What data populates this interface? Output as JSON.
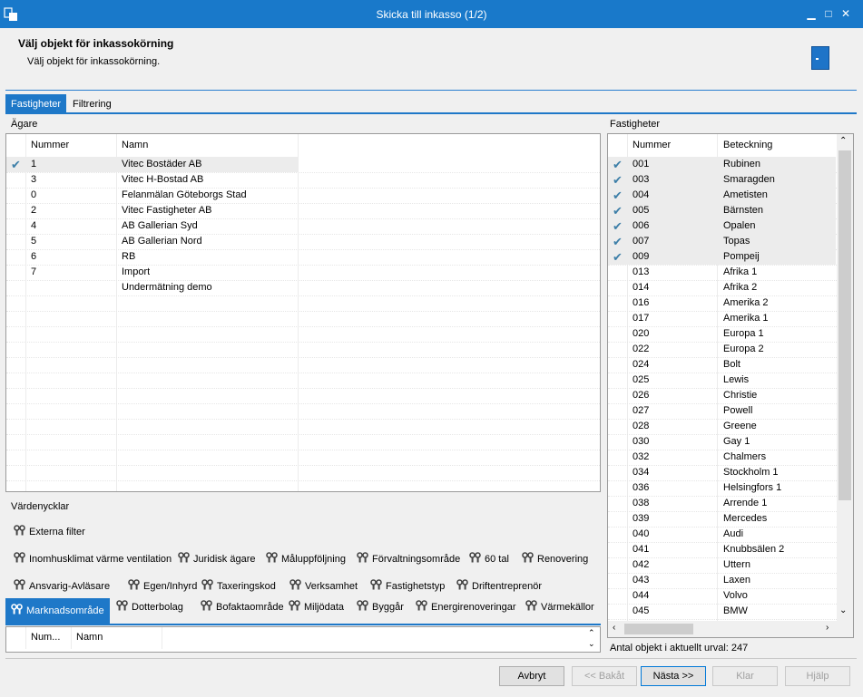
{
  "window": {
    "title": "Skicka till inkasso (1/2)",
    "icon": "app-window-icon",
    "controls": [
      "minimize-icon",
      "maximize-icon",
      "close-icon"
    ]
  },
  "header": {
    "title": "Välj objekt för inkassokörning",
    "subtitle": "Välj objekt för inkassokörning.",
    "icon": "door-icon"
  },
  "tabs": [
    {
      "label": "Fastigheter",
      "active": true
    },
    {
      "label": "Filtrering",
      "active": false
    }
  ],
  "owners": {
    "label": "Ägare",
    "columns": [
      "Nummer",
      "Namn"
    ],
    "rows": [
      {
        "checked": true,
        "number": "1",
        "name": "Vitec Bostäder AB"
      },
      {
        "checked": false,
        "number": "3",
        "name": "Vitec H-Bostad AB"
      },
      {
        "checked": false,
        "number": "0",
        "name": "Felanmälan Göteborgs Stad"
      },
      {
        "checked": false,
        "number": "2",
        "name": "Vitec Fastigheter AB"
      },
      {
        "checked": false,
        "number": "4",
        "name": "AB Gallerian Syd"
      },
      {
        "checked": false,
        "number": "5",
        "name": "AB Gallerian Nord"
      },
      {
        "checked": false,
        "number": "6",
        "name": "RB"
      },
      {
        "checked": false,
        "number": "7",
        "name": "Import"
      },
      {
        "checked": false,
        "number": "",
        "name": "Undermätning demo"
      }
    ]
  },
  "properties": {
    "label": "Fastigheter",
    "columns": [
      "Nummer",
      "Beteckning"
    ],
    "rows": [
      {
        "checked": true,
        "number": "001",
        "name": "Rubinen"
      },
      {
        "checked": true,
        "number": "003",
        "name": "Smaragden"
      },
      {
        "checked": true,
        "number": "004",
        "name": "Ametisten"
      },
      {
        "checked": true,
        "number": "005",
        "name": "Bärnsten"
      },
      {
        "checked": true,
        "number": "006",
        "name": "Opalen"
      },
      {
        "checked": true,
        "number": "007",
        "name": "Topas"
      },
      {
        "checked": true,
        "number": "009",
        "name": "Pompeij"
      },
      {
        "checked": false,
        "number": "013",
        "name": "Afrika 1"
      },
      {
        "checked": false,
        "number": "014",
        "name": "Afrika 2"
      },
      {
        "checked": false,
        "number": "016",
        "name": "Amerika 2"
      },
      {
        "checked": false,
        "number": "017",
        "name": "Amerika 1"
      },
      {
        "checked": false,
        "number": "020",
        "name": "Europa 1"
      },
      {
        "checked": false,
        "number": "022",
        "name": "Europa 2"
      },
      {
        "checked": false,
        "number": "024",
        "name": "Bolt"
      },
      {
        "checked": false,
        "number": "025",
        "name": "Lewis"
      },
      {
        "checked": false,
        "number": "026",
        "name": "Christie"
      },
      {
        "checked": false,
        "number": "027",
        "name": "Powell"
      },
      {
        "checked": false,
        "number": "028",
        "name": "Greene"
      },
      {
        "checked": false,
        "number": "030",
        "name": "Gay 1"
      },
      {
        "checked": false,
        "number": "032",
        "name": "Chalmers"
      },
      {
        "checked": false,
        "number": "034",
        "name": "Stockholm 1"
      },
      {
        "checked": false,
        "number": "036",
        "name": "Helsingfors 1"
      },
      {
        "checked": false,
        "number": "038",
        "name": "Arrende 1"
      },
      {
        "checked": false,
        "number": "039",
        "name": "Mercedes"
      },
      {
        "checked": false,
        "number": "040",
        "name": "Audi"
      },
      {
        "checked": false,
        "number": "041",
        "name": "Knubbsälen 2"
      },
      {
        "checked": false,
        "number": "042",
        "name": "Uttern"
      },
      {
        "checked": false,
        "number": "043",
        "name": "Laxen"
      },
      {
        "checked": false,
        "number": "044",
        "name": "Volvo"
      },
      {
        "checked": false,
        "number": "045",
        "name": "BMW"
      }
    ],
    "count_text": "Antal objekt i aktuellt urval: 247"
  },
  "value_keys": {
    "label": "Värdenycklar",
    "row1": [
      "Externa filter"
    ],
    "row2": [
      "Inomhusklimat värme ventilation",
      "Juridisk ägare",
      "Måluppföljning",
      "Förvaltningsområde",
      "60 tal",
      "Renovering"
    ],
    "row3": [
      "Ansvarig-Avläsare",
      "Egen/Inhyrd",
      "Taxeringskod",
      "Verksamhet",
      "Fastighetstyp",
      "Driftentreprenör"
    ],
    "row4": [
      {
        "label": "Marknadsområde",
        "active": true
      },
      {
        "label": "Dotterbolag"
      },
      {
        "label": "Bofaktaområde"
      },
      {
        "label": "Miljödata"
      },
      {
        "label": "Byggår"
      },
      {
        "label": "Energirenoveringar"
      },
      {
        "label": "Värmekällor"
      }
    ]
  },
  "key_grid": {
    "columns": [
      "Num...",
      "Namn"
    ]
  },
  "buttons": {
    "cancel": "Avbryt",
    "back": "<< Bakåt",
    "next": "Nästa >>",
    "finish": "Klar",
    "help": "Hjälp"
  },
  "colors": {
    "accent": "#1e78c8",
    "check": "#3d7fa8"
  }
}
